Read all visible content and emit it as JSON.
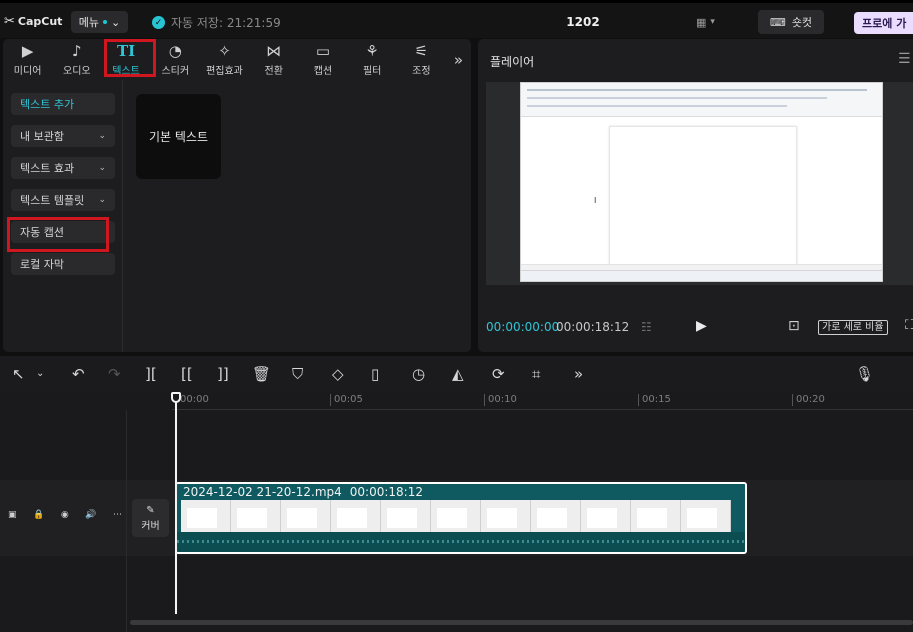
{
  "topbar": {
    "logo": "CapCut",
    "menu_label": "메뉴",
    "autosave": "자동 저장: 21:21:59",
    "project_title": "1202",
    "shortcut_label": "숏컷",
    "pro_label": "프로에 가"
  },
  "toolbar": {
    "items": [
      {
        "label": "미디어",
        "icon": "media-icon"
      },
      {
        "label": "오디오",
        "icon": "audio-icon"
      },
      {
        "label": "텍스트",
        "icon": "text-icon"
      },
      {
        "label": "스티커",
        "icon": "sticker-icon"
      },
      {
        "label": "편집효과",
        "icon": "effects-icon"
      },
      {
        "label": "전환",
        "icon": "transition-icon"
      },
      {
        "label": "캡션",
        "icon": "caption-icon"
      },
      {
        "label": "필터",
        "icon": "filter-icon"
      },
      {
        "label": "조정",
        "icon": "adjust-icon"
      }
    ],
    "active_index": 2,
    "accent_color": "#30c4d4",
    "highlight_color": "#d0161f"
  },
  "side_nav": {
    "items": [
      {
        "label": "텍스트 추가",
        "chevron": false
      },
      {
        "label": "내 보관함",
        "chevron": true
      },
      {
        "label": "텍스트 효과",
        "chevron": true
      },
      {
        "label": "텍스트 템플릿",
        "chevron": true
      },
      {
        "label": "자동 캡션",
        "chevron": false
      },
      {
        "label": "로컬 자막",
        "chevron": false
      }
    ]
  },
  "content": {
    "basic_text_card": "기본 텍스트"
  },
  "player": {
    "title": "플레이어",
    "time_current": "00:00:00:00",
    "time_total": "00:00:18:12",
    "ratio_label": "가로 세로 비율"
  },
  "timeline": {
    "ticks": [
      "00:00",
      "00:05",
      "00:10",
      "00:15",
      "00:20"
    ],
    "cover_label": "커버",
    "clip": {
      "filename": "2024-12-02 21-20-12.mp4",
      "duration": "00:00:18:12"
    }
  }
}
